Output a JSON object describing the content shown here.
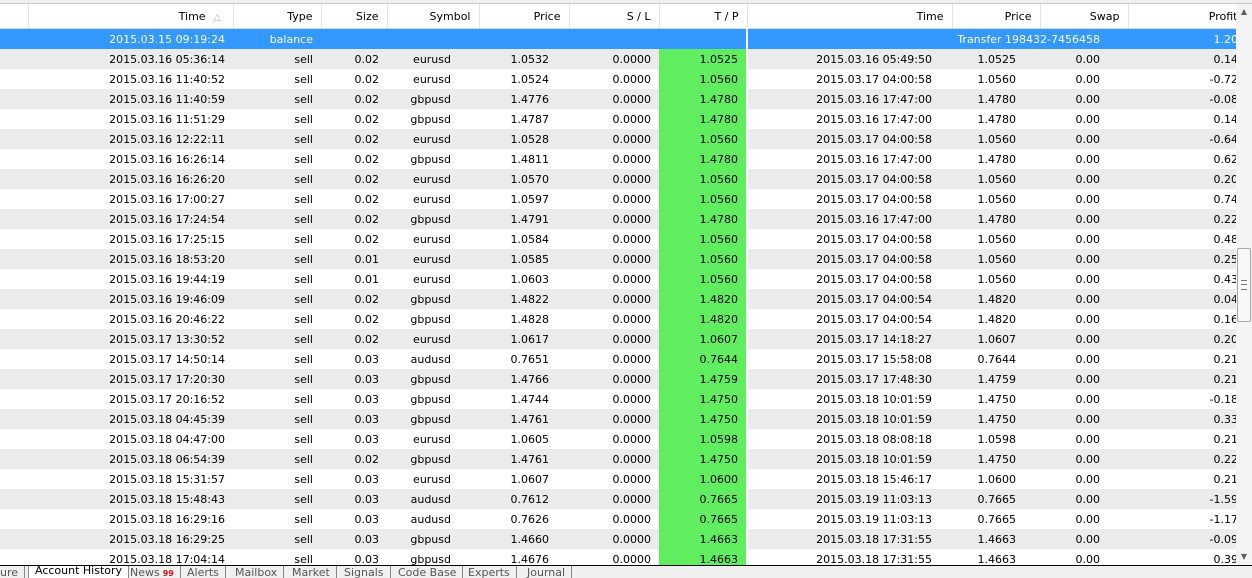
{
  "columns": [
    "Time",
    "Type",
    "Size",
    "Symbol",
    "Price",
    "S / L",
    "T / P",
    "Time",
    "Price",
    "Swap",
    "Profit"
  ],
  "sort_indicator": "sort-ascending",
  "balance_row": {
    "time": "2015.03.15 09:19:24",
    "type": "balance",
    "comment": "Transfer 198432-7456458",
    "profit": "1.20"
  },
  "rows": [
    {
      "time": "2015.03.16 05:36:14",
      "type": "sell",
      "size": "0.02",
      "symbol": "eurusd",
      "price": "1.0532",
      "sl": "0.0000",
      "tp": "1.0525",
      "close_time": "2015.03.16 05:49:50",
      "close_price": "1.0525",
      "swap": "0.00",
      "profit": "0.14"
    },
    {
      "time": "2015.03.16 11:40:52",
      "type": "sell",
      "size": "0.02",
      "symbol": "eurusd",
      "price": "1.0524",
      "sl": "0.0000",
      "tp": "1.0560",
      "close_time": "2015.03.17 04:00:58",
      "close_price": "1.0560",
      "swap": "0.00",
      "profit": "-0.72"
    },
    {
      "time": "2015.03.16 11:40:59",
      "type": "sell",
      "size": "0.02",
      "symbol": "gbpusd",
      "price": "1.4776",
      "sl": "0.0000",
      "tp": "1.4780",
      "close_time": "2015.03.16 17:47:00",
      "close_price": "1.4780",
      "swap": "0.00",
      "profit": "-0.08"
    },
    {
      "time": "2015.03.16 11:51:29",
      "type": "sell",
      "size": "0.02",
      "symbol": "gbpusd",
      "price": "1.4787",
      "sl": "0.0000",
      "tp": "1.4780",
      "close_time": "2015.03.16 17:47:00",
      "close_price": "1.4780",
      "swap": "0.00",
      "profit": "0.14"
    },
    {
      "time": "2015.03.16 12:22:11",
      "type": "sell",
      "size": "0.02",
      "symbol": "eurusd",
      "price": "1.0528",
      "sl": "0.0000",
      "tp": "1.0560",
      "close_time": "2015.03.17 04:00:58",
      "close_price": "1.0560",
      "swap": "0.00",
      "profit": "-0.64"
    },
    {
      "time": "2015.03.16 16:26:14",
      "type": "sell",
      "size": "0.02",
      "symbol": "gbpusd",
      "price": "1.4811",
      "sl": "0.0000",
      "tp": "1.4780",
      "close_time": "2015.03.16 17:47:00",
      "close_price": "1.4780",
      "swap": "0.00",
      "profit": "0.62"
    },
    {
      "time": "2015.03.16 16:26:20",
      "type": "sell",
      "size": "0.02",
      "symbol": "eurusd",
      "price": "1.0570",
      "sl": "0.0000",
      "tp": "1.0560",
      "close_time": "2015.03.17 04:00:58",
      "close_price": "1.0560",
      "swap": "0.00",
      "profit": "0.20"
    },
    {
      "time": "2015.03.16 17:00:27",
      "type": "sell",
      "size": "0.02",
      "symbol": "eurusd",
      "price": "1.0597",
      "sl": "0.0000",
      "tp": "1.0560",
      "close_time": "2015.03.17 04:00:58",
      "close_price": "1.0560",
      "swap": "0.00",
      "profit": "0.74"
    },
    {
      "time": "2015.03.16 17:24:54",
      "type": "sell",
      "size": "0.02",
      "symbol": "gbpusd",
      "price": "1.4791",
      "sl": "0.0000",
      "tp": "1.4780",
      "close_time": "2015.03.16 17:47:00",
      "close_price": "1.4780",
      "swap": "0.00",
      "profit": "0.22"
    },
    {
      "time": "2015.03.16 17:25:15",
      "type": "sell",
      "size": "0.02",
      "symbol": "eurusd",
      "price": "1.0584",
      "sl": "0.0000",
      "tp": "1.0560",
      "close_time": "2015.03.17 04:00:58",
      "close_price": "1.0560",
      "swap": "0.00",
      "profit": "0.48"
    },
    {
      "time": "2015.03.16 18:53:20",
      "type": "sell",
      "size": "0.01",
      "symbol": "eurusd",
      "price": "1.0585",
      "sl": "0.0000",
      "tp": "1.0560",
      "close_time": "2015.03.17 04:00:58",
      "close_price": "1.0560",
      "swap": "0.00",
      "profit": "0.25"
    },
    {
      "time": "2015.03.16 19:44:19",
      "type": "sell",
      "size": "0.01",
      "symbol": "eurusd",
      "price": "1.0603",
      "sl": "0.0000",
      "tp": "1.0560",
      "close_time": "2015.03.17 04:00:58",
      "close_price": "1.0560",
      "swap": "0.00",
      "profit": "0.43"
    },
    {
      "time": "2015.03.16 19:46:09",
      "type": "sell",
      "size": "0.02",
      "symbol": "gbpusd",
      "price": "1.4822",
      "sl": "0.0000",
      "tp": "1.4820",
      "close_time": "2015.03.17 04:00:54",
      "close_price": "1.4820",
      "swap": "0.00",
      "profit": "0.04"
    },
    {
      "time": "2015.03.16 20:46:22",
      "type": "sell",
      "size": "0.02",
      "symbol": "gbpusd",
      "price": "1.4828",
      "sl": "0.0000",
      "tp": "1.4820",
      "close_time": "2015.03.17 04:00:54",
      "close_price": "1.4820",
      "swap": "0.00",
      "profit": "0.16"
    },
    {
      "time": "2015.03.17 13:30:52",
      "type": "sell",
      "size": "0.02",
      "symbol": "eurusd",
      "price": "1.0617",
      "sl": "0.0000",
      "tp": "1.0607",
      "close_time": "2015.03.17 14:18:27",
      "close_price": "1.0607",
      "swap": "0.00",
      "profit": "0.20"
    },
    {
      "time": "2015.03.17 14:50:14",
      "type": "sell",
      "size": "0.03",
      "symbol": "audusd",
      "price": "0.7651",
      "sl": "0.0000",
      "tp": "0.7644",
      "close_time": "2015.03.17 15:58:08",
      "close_price": "0.7644",
      "swap": "0.00",
      "profit": "0.21"
    },
    {
      "time": "2015.03.17 17:20:30",
      "type": "sell",
      "size": "0.03",
      "symbol": "gbpusd",
      "price": "1.4766",
      "sl": "0.0000",
      "tp": "1.4759",
      "close_time": "2015.03.17 17:48:30",
      "close_price": "1.4759",
      "swap": "0.00",
      "profit": "0.21"
    },
    {
      "time": "2015.03.17 20:16:52",
      "type": "sell",
      "size": "0.03",
      "symbol": "gbpusd",
      "price": "1.4744",
      "sl": "0.0000",
      "tp": "1.4750",
      "close_time": "2015.03.18 10:01:59",
      "close_price": "1.4750",
      "swap": "0.00",
      "profit": "-0.18"
    },
    {
      "time": "2015.03.18 04:45:39",
      "type": "sell",
      "size": "0.03",
      "symbol": "gbpusd",
      "price": "1.4761",
      "sl": "0.0000",
      "tp": "1.4750",
      "close_time": "2015.03.18 10:01:59",
      "close_price": "1.4750",
      "swap": "0.00",
      "profit": "0.33"
    },
    {
      "time": "2015.03.18 04:47:00",
      "type": "sell",
      "size": "0.03",
      "symbol": "eurusd",
      "price": "1.0605",
      "sl": "0.0000",
      "tp": "1.0598",
      "close_time": "2015.03.18 08:08:18",
      "close_price": "1.0598",
      "swap": "0.00",
      "profit": "0.21"
    },
    {
      "time": "2015.03.18 06:54:39",
      "type": "sell",
      "size": "0.02",
      "symbol": "gbpusd",
      "price": "1.4761",
      "sl": "0.0000",
      "tp": "1.4750",
      "close_time": "2015.03.18 10:01:59",
      "close_price": "1.4750",
      "swap": "0.00",
      "profit": "0.22"
    },
    {
      "time": "2015.03.18 15:31:57",
      "type": "sell",
      "size": "0.03",
      "symbol": "eurusd",
      "price": "1.0607",
      "sl": "0.0000",
      "tp": "1.0600",
      "close_time": "2015.03.18 15:46:17",
      "close_price": "1.0600",
      "swap": "0.00",
      "profit": "0.21"
    },
    {
      "time": "2015.03.18 15:48:43",
      "type": "sell",
      "size": "0.03",
      "symbol": "audusd",
      "price": "0.7612",
      "sl": "0.0000",
      "tp": "0.7665",
      "close_time": "2015.03.19 11:03:13",
      "close_price": "0.7665",
      "swap": "0.00",
      "profit": "-1.59"
    },
    {
      "time": "2015.03.18 16:29:16",
      "type": "sell",
      "size": "0.03",
      "symbol": "audusd",
      "price": "0.7626",
      "sl": "0.0000",
      "tp": "0.7665",
      "close_time": "2015.03.19 11:03:13",
      "close_price": "0.7665",
      "swap": "0.00",
      "profit": "-1.17"
    },
    {
      "time": "2015.03.18 16:29:25",
      "type": "sell",
      "size": "0.03",
      "symbol": "gbpusd",
      "price": "1.4660",
      "sl": "0.0000",
      "tp": "1.4663",
      "close_time": "2015.03.18 17:31:55",
      "close_price": "1.4663",
      "swap": "0.00",
      "profit": "-0.09"
    },
    {
      "time": "2015.03.18 17:04:14",
      "type": "sell",
      "size": "0.03",
      "symbol": "gbpusd",
      "price": "1.4676",
      "sl": "0.0000",
      "tp": "1.4663",
      "close_time": "2015.03.18 17:31:55",
      "close_price": "1.4663",
      "swap": "0.00",
      "profit": "0.39"
    }
  ],
  "tabs": [
    {
      "label": "ure",
      "active": false
    },
    {
      "label": "Account History",
      "active": true
    },
    {
      "label": "News",
      "badge": "99",
      "active": false
    },
    {
      "label": "Alerts",
      "active": false
    },
    {
      "label": "Mailbox",
      "active": false
    },
    {
      "label": "Market",
      "active": false
    },
    {
      "label": "Signals",
      "active": false
    },
    {
      "label": "Code Base",
      "active": false
    },
    {
      "label": "Experts",
      "active": false
    },
    {
      "label": "Journal",
      "active": false
    }
  ],
  "colors": {
    "selected_row": "#3399ff",
    "tp_highlight": "#60ee60",
    "alt_row": "#ebebeb",
    "badge": "#e01010"
  }
}
